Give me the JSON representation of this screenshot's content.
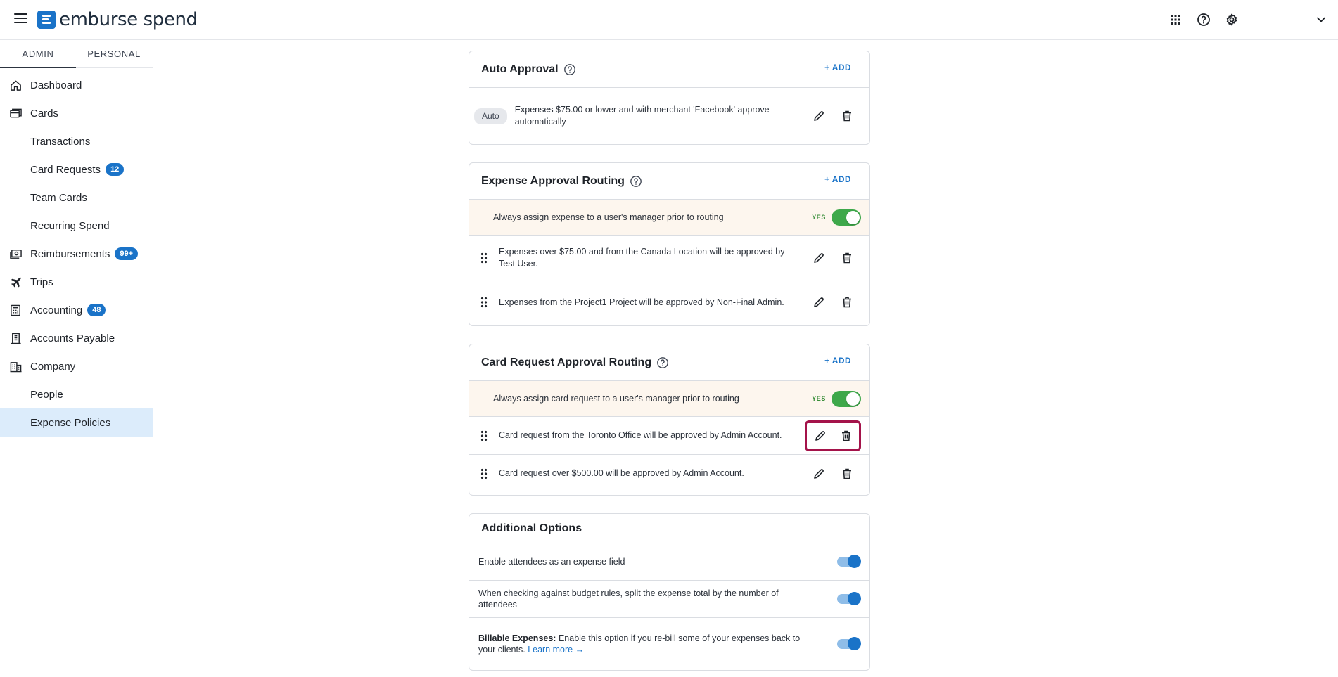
{
  "brand": {
    "name": "emburse spend",
    "accent": "#1a73c8"
  },
  "sidebar": {
    "tabs": [
      {
        "label": "ADMIN"
      },
      {
        "label": "PERSONAL"
      }
    ],
    "items": [
      {
        "label": "Dashboard",
        "icon": "home-icon"
      },
      {
        "label": "Cards",
        "icon": "cards-icon"
      },
      {
        "label": "Transactions"
      },
      {
        "label": "Card Requests",
        "badge": "12"
      },
      {
        "label": "Team Cards"
      },
      {
        "label": "Recurring Spend"
      },
      {
        "label": "Reimbursements",
        "icon": "cash-icon",
        "badge": "99+"
      },
      {
        "label": "Trips",
        "icon": "plane-icon"
      },
      {
        "label": "Accounting",
        "icon": "calculator-icon",
        "badge": "48"
      },
      {
        "label": "Accounts Payable",
        "icon": "receipt-icon"
      },
      {
        "label": "Company",
        "icon": "building-icon"
      },
      {
        "label": "People"
      },
      {
        "label": "Expense Policies"
      }
    ]
  },
  "auto_approval": {
    "title": "Auto Approval",
    "add_label": "+ ADD",
    "rules": [
      {
        "chip": "Auto",
        "text": "Expenses $75.00 or lower and with merchant 'Facebook' approve automatically"
      }
    ]
  },
  "expense_routing": {
    "title": "Expense Approval Routing",
    "add_label": "+ ADD",
    "manager_text": "Always assign expense to a user's manager prior to routing",
    "manager_value": "YES",
    "rules": [
      {
        "text": "Expenses over $75.00 and from the Canada Location will be approved by Test User."
      },
      {
        "text": "Expenses from the Project1 Project will be approved by Non-Final Admin."
      }
    ]
  },
  "card_routing": {
    "title": "Card Request Approval Routing",
    "add_label": "+ ADD",
    "manager_text": "Always assign card request to a user's manager prior to routing",
    "manager_value": "YES",
    "rules": [
      {
        "text": "Card request from the Toronto Office will be approved by Admin Account."
      },
      {
        "text": "Card request over $500.00 will be approved by Admin Account."
      }
    ]
  },
  "additional_options": {
    "title": "Additional Options",
    "options": [
      {
        "text": "Enable attendees as an expense field",
        "enabled": true
      },
      {
        "text": "When checking against budget rules, split the expense total by the number of attendees",
        "enabled": true
      },
      {
        "label": "Billable Expenses:",
        "text": "Enable this option if you re-bill some of your expenses back to your clients.",
        "link": "Learn more →",
        "enabled": true
      }
    ]
  }
}
